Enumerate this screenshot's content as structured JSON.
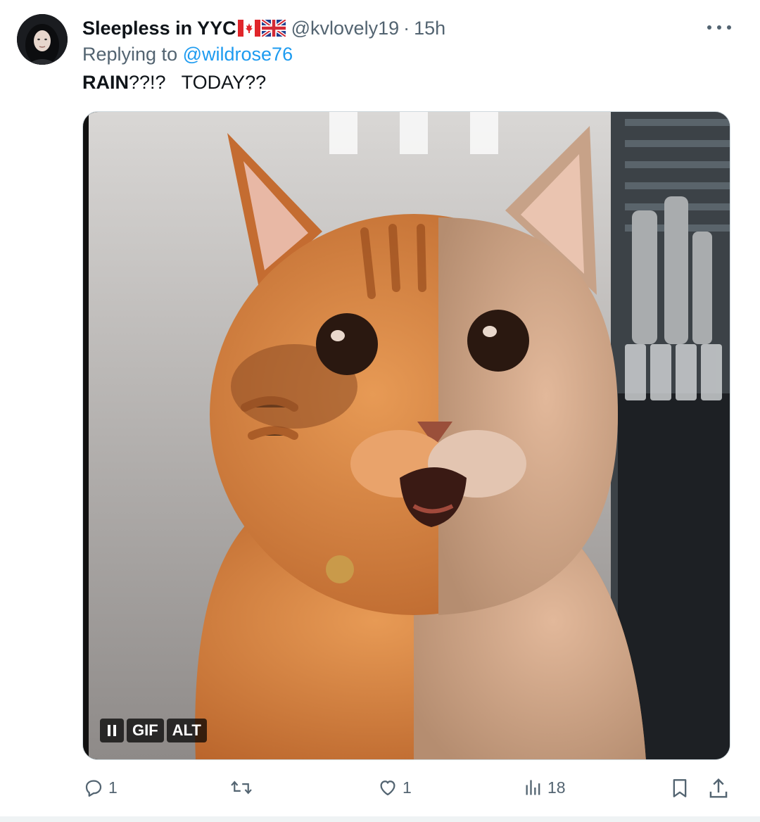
{
  "tweet": {
    "display_name": "Sleepless in YYC",
    "flags": [
      "canada-flag",
      "uk-flag"
    ],
    "handle": "@kvlovely19",
    "separator": "·",
    "timestamp": "15h",
    "more_icon": "more-horizontal-icon",
    "reply_prefix": "Replying to",
    "reply_target": "@wildrose76",
    "text_bold": "RAIN",
    "text_rest": "??!?   TODAY??"
  },
  "media": {
    "type": "gif",
    "subject": "orange cat with wide eyes and open mouth",
    "pause_icon": "pause-icon",
    "gif_badge": "GIF",
    "alt_badge": "ALT"
  },
  "actions": {
    "reply": {
      "icon": "reply-icon",
      "count": "1"
    },
    "repost": {
      "icon": "repost-icon",
      "count": ""
    },
    "like": {
      "icon": "like-icon",
      "count": "1"
    },
    "views": {
      "icon": "views-icon",
      "count": "18"
    },
    "bookmark": {
      "icon": "bookmark-icon"
    },
    "share": {
      "icon": "share-icon"
    }
  },
  "colors": {
    "text": "#0f1419",
    "secondary": "#536471",
    "link": "#1d9bf0",
    "border": "#cfd9de"
  }
}
